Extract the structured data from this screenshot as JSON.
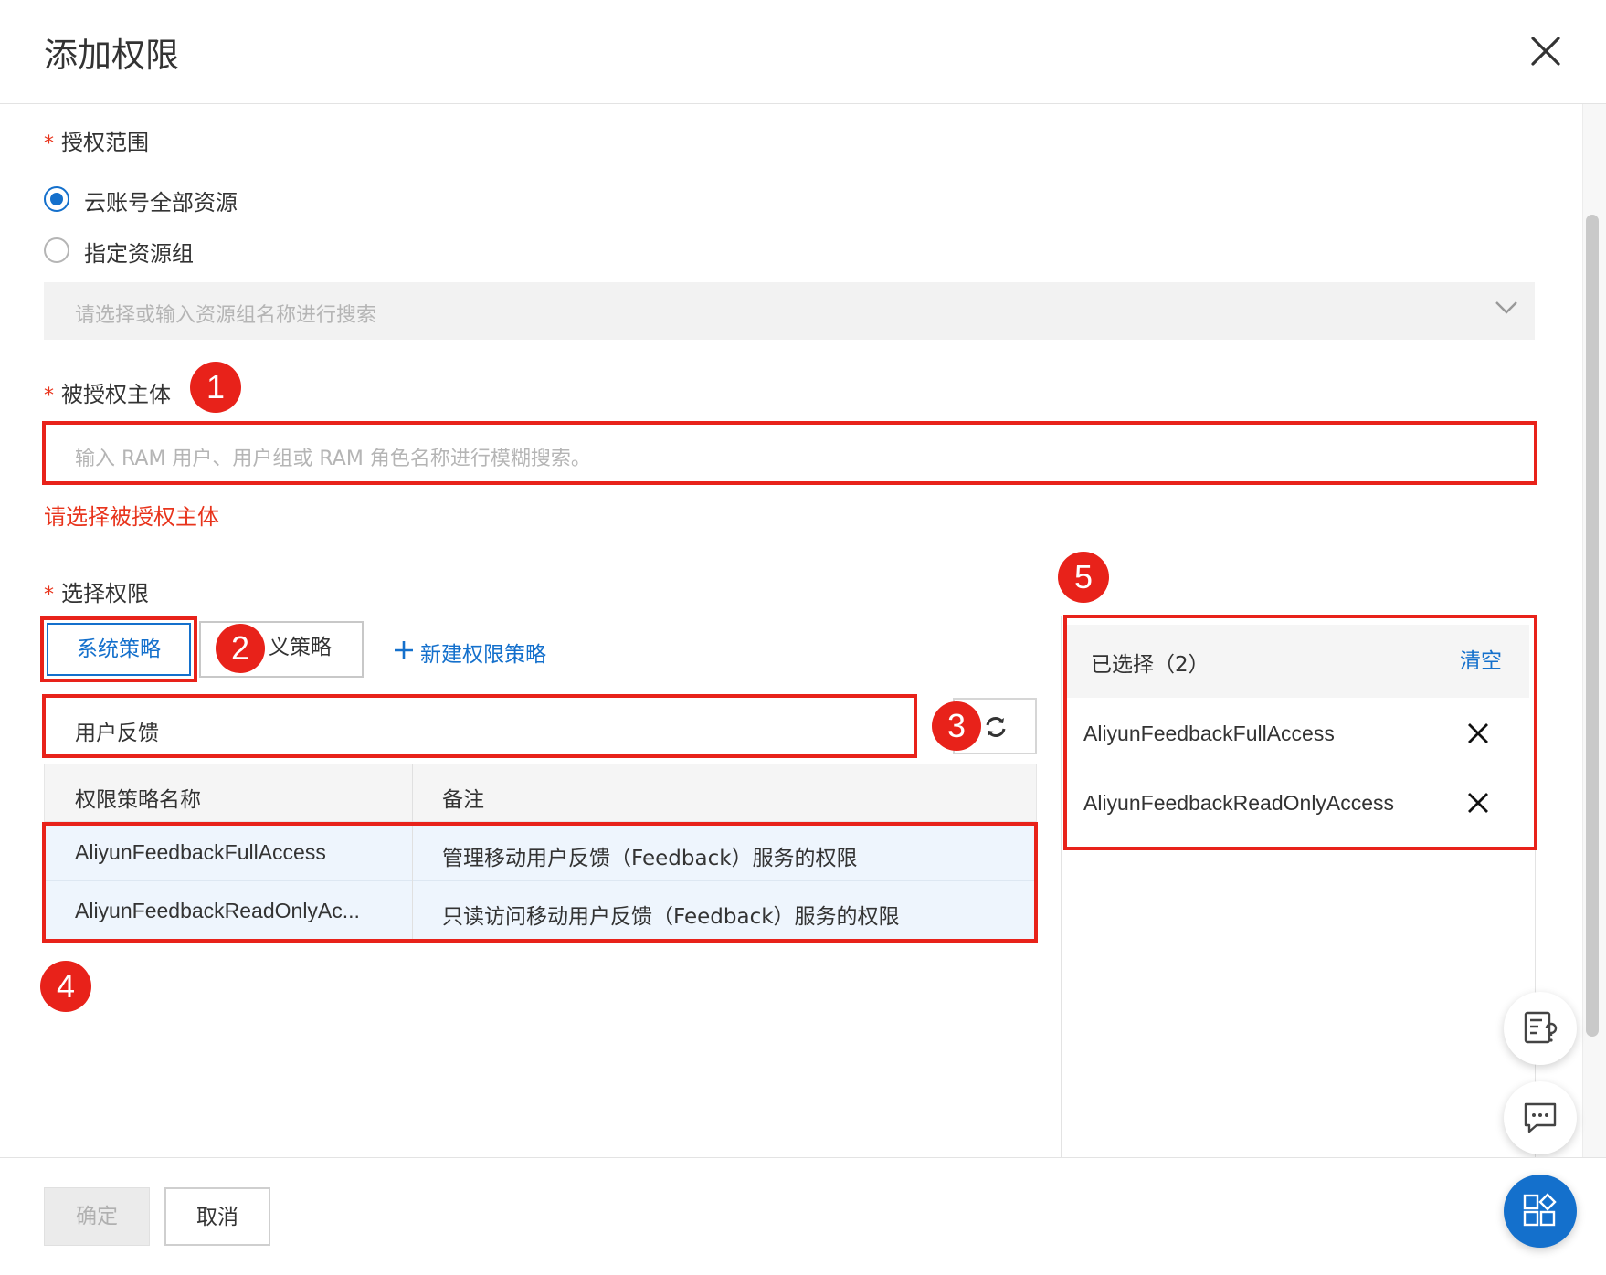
{
  "dialog": {
    "title": "添加权限"
  },
  "scope": {
    "required_mark": "*",
    "label": "授权范围",
    "options": [
      {
        "label": "云账号全部资源",
        "selected": true
      },
      {
        "label": "指定资源组",
        "selected": false
      }
    ],
    "resource_group_placeholder": "请选择或输入资源组名称进行搜索"
  },
  "principal": {
    "required_mark": "*",
    "label": "被授权主体",
    "placeholder": "输入 RAM 用户、用户组或 RAM 角色名称进行模糊搜索。",
    "error": "请选择被授权主体"
  },
  "permissions": {
    "required_mark": "*",
    "label": "选择权限",
    "tabs": [
      {
        "label": "系统策略",
        "active": true
      },
      {
        "label": "义策略",
        "active": false
      }
    ],
    "new_policy_label": "新建权限策略",
    "search_value": "用户反馈",
    "table": {
      "columns": [
        "权限策略名称",
        "备注"
      ],
      "rows": [
        {
          "name": "AliyunFeedbackFullAccess",
          "note": "管理移动用户反馈（Feedback）服务的权限"
        },
        {
          "name": "AliyunFeedbackReadOnlyAc...",
          "note": "只读访问移动用户反馈（Feedback）服务的权限"
        }
      ]
    }
  },
  "selected": {
    "title": "已选择（2）",
    "clear_label": "清空",
    "items": [
      "AliyunFeedbackFullAccess",
      "AliyunFeedbackReadOnlyAccess"
    ]
  },
  "annotations": {
    "b1": "1",
    "b2": "2",
    "b3": "3",
    "b4": "4",
    "b5": "5"
  },
  "footer": {
    "ok_label": "确定",
    "cancel_label": "取消"
  },
  "colors": {
    "accent": "#1470cc",
    "error": "#e8341c",
    "annotation": "#e8221a"
  }
}
